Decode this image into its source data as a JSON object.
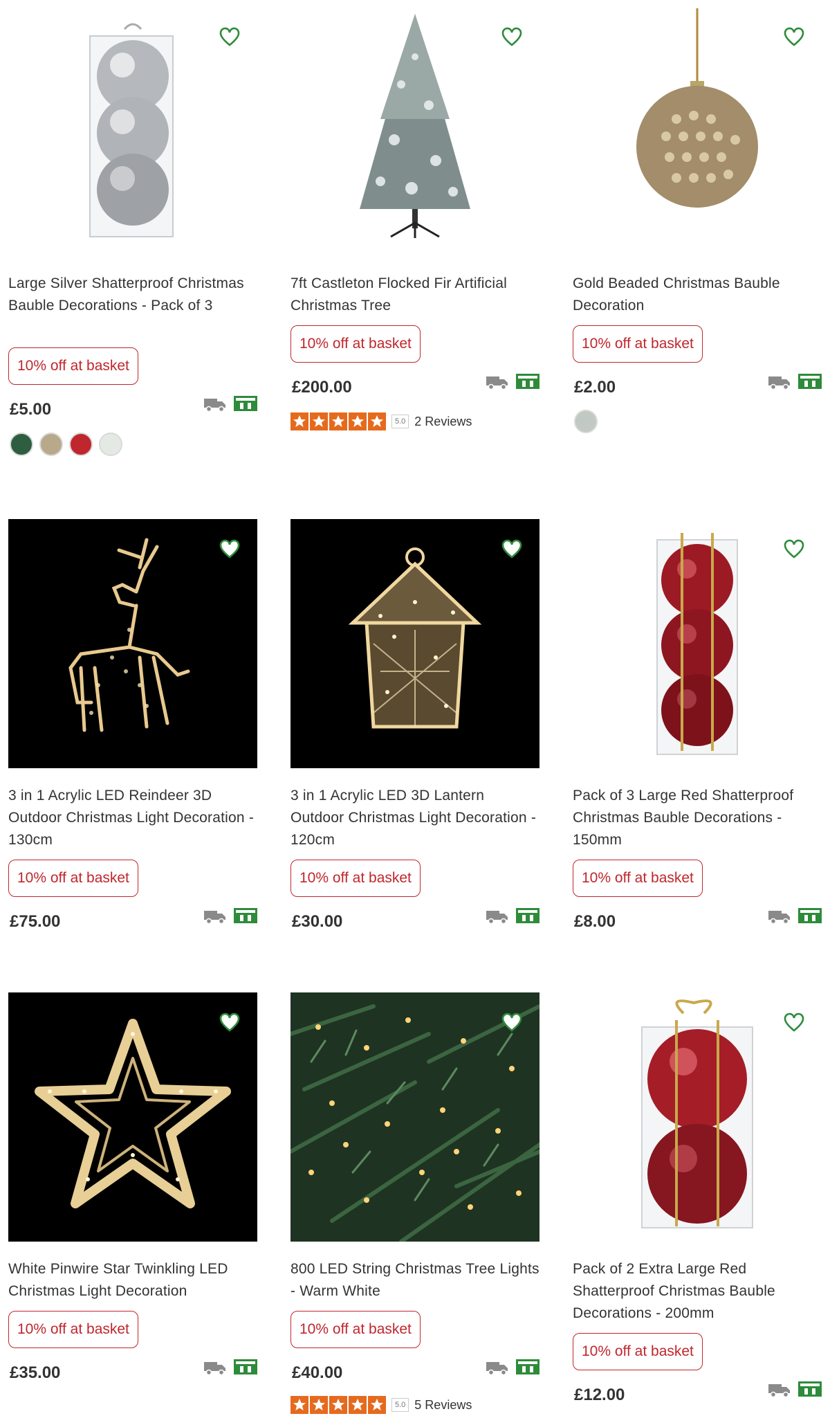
{
  "promo_label": "10% off at basket",
  "products": [
    {
      "title": "Large Silver Shatterproof Christmas Bauble Decorations - Pack of 3",
      "price": "£5.00",
      "image": "silver-baubles-image",
      "swatches": [
        "#2d5e3f",
        "#b8a98a",
        "#c0262d",
        "#e4e9e4"
      ]
    },
    {
      "title": "7ft Castleton Flocked Fir Artificial Christmas Tree",
      "price": "£200.00",
      "image": "flocked-tree-image",
      "rating": {
        "score": "5.0",
        "reviews": "2 Reviews"
      }
    },
    {
      "title": "Gold Beaded Christmas Bauble Decoration",
      "price": "£2.00",
      "image": "gold-bauble-image",
      "swatches": [
        "#c2c8c2"
      ]
    },
    {
      "title": "3 in 1 Acrylic LED Reindeer 3D Outdoor Christmas Light Decoration - 130cm",
      "price": "£75.00",
      "image": "reindeer-light-image"
    },
    {
      "title": "3 in 1 Acrylic LED 3D Lantern Outdoor Christmas Light Decoration - 120cm",
      "price": "£30.00",
      "image": "lantern-light-image"
    },
    {
      "title": "Pack of 3 Large Red Shatterproof Christmas Bauble Decorations - 150mm",
      "price": "£8.00",
      "image": "red-baubles-image"
    },
    {
      "title": "White Pinwire Star Twinkling LED Christmas Light Decoration",
      "price": "£35.00",
      "image": "star-light-image"
    },
    {
      "title": "800 LED String Christmas Tree Lights - Warm White",
      "price": "£40.00",
      "image": "string-lights-image",
      "rating": {
        "score": "5.0",
        "reviews": "5 Reviews"
      }
    },
    {
      "title": "Pack of 2 Extra Large Red Shatterproof Christmas Bauble Decorations - 200mm",
      "price": "£12.00",
      "image": "red-baubles-2-image"
    }
  ],
  "colors": {
    "promo": "#c0262d",
    "heart": "#2e8b3a",
    "star": "#e66a1e",
    "collect": "#2e8b3a",
    "delivery": "#8a8a8a"
  }
}
